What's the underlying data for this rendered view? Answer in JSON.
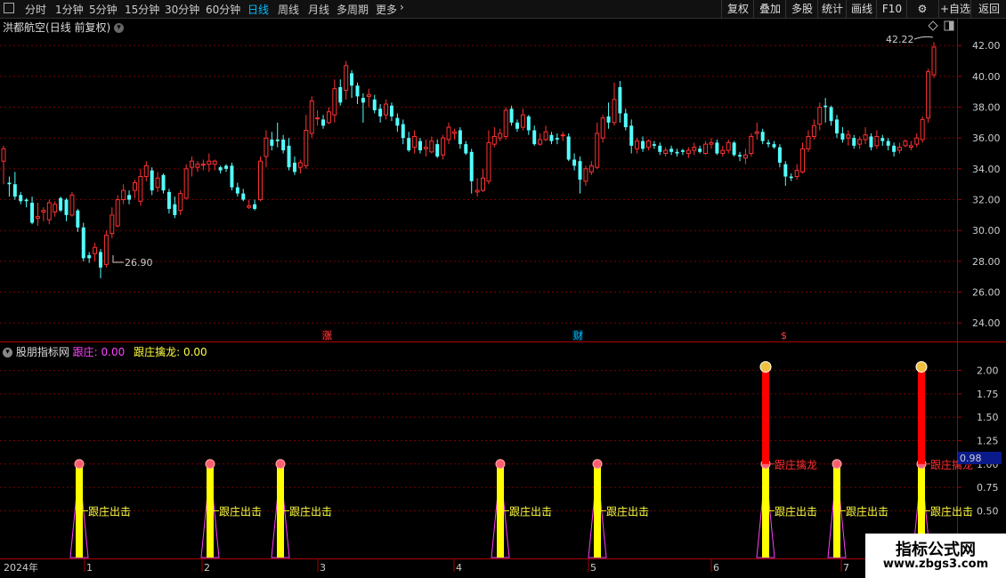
{
  "toolbar": {
    "icon": "window-icon",
    "periods": [
      "分时",
      "1分钟",
      "5分钟",
      "15分钟",
      "30分钟",
      "60分钟",
      "日线",
      "周线",
      "月线",
      "多周期",
      "更多"
    ],
    "active_period": "日线",
    "right_buttons": [
      "复权",
      "叠加",
      "多股",
      "统计",
      "画线",
      "F10",
      "+自选",
      "返回"
    ]
  },
  "main_pane": {
    "stock_name": "洪都航空",
    "mode": "(日线 前复权)",
    "high_label": "42.22",
    "low_label": "26.90",
    "markers": [
      {
        "text": "涨",
        "color": "#ff4040"
      },
      {
        "text": "财",
        "color": "#00bfff"
      },
      {
        "text": "$",
        "color": "#ff4040"
      }
    ]
  },
  "indicator_pane": {
    "name": "股朋指标网",
    "series_a_label": "跟庄:",
    "series_a_value": "0.00",
    "series_b_label": "跟庄擒龙:",
    "series_b_value": "0.00",
    "current_value": "0.98",
    "signal_exit_label": "跟庄出击",
    "signal_dragon_label": "跟庄擒龙"
  },
  "chart_data": {
    "type": "candlestick",
    "price_axis": {
      "ticks": [
        "42.00",
        "40.00",
        "38.00",
        "36.00",
        "34.00",
        "32.00",
        "30.00",
        "28.00",
        "26.00",
        "24.00"
      ],
      "ylim": [
        22.8,
        43.8
      ],
      "grid": true
    },
    "indicator_axis": {
      "ticks": [
        "2.00",
        "1.75",
        "1.50",
        "1.25",
        "1.00",
        "0.75",
        "0.50"
      ],
      "ylim": [
        0,
        2.3
      ]
    },
    "x_axis": {
      "labels": [
        "2024年",
        "1",
        "2",
        "3",
        "4",
        "5",
        "6",
        "7"
      ]
    },
    "candles": [
      [
        34.5,
        35.3,
        33.0,
        35.5
      ],
      [
        33.1,
        33.0,
        32.2,
        33.5
      ],
      [
        33.0,
        32.2,
        32.0,
        33.8
      ],
      [
        32.3,
        31.9,
        31.7,
        32.5
      ],
      [
        32.0,
        31.9,
        31.5,
        32.1
      ],
      [
        31.8,
        30.5,
        30.4,
        32.2
      ],
      [
        30.8,
        30.9,
        30.3,
        31.8
      ],
      [
        31.2,
        31.3,
        30.6,
        31.5
      ],
      [
        30.7,
        31.8,
        30.4,
        32.0
      ],
      [
        31.2,
        31.7,
        30.9,
        31.9
      ],
      [
        32.1,
        31.3,
        31.2,
        32.2
      ],
      [
        32.0,
        31.0,
        30.6,
        32.1
      ],
      [
        31.0,
        32.3,
        30.9,
        32.5
      ],
      [
        31.3,
        30.2,
        29.9,
        31.4
      ],
      [
        30.2,
        28.2,
        28.0,
        30.5
      ],
      [
        28.4,
        28.2,
        27.9,
        28.6
      ],
      [
        28.5,
        28.9,
        28.0,
        29.2
      ],
      [
        28.6,
        27.6,
        26.9,
        28.8
      ],
      [
        27.8,
        29.7,
        27.6,
        30.0
      ],
      [
        29.8,
        31.0,
        29.5,
        31.5
      ],
      [
        30.3,
        32.0,
        30.2,
        32.3
      ],
      [
        32.0,
        32.6,
        31.7,
        33.0
      ],
      [
        32.3,
        32.0,
        31.7,
        32.6
      ],
      [
        32.6,
        33.1,
        32.1,
        33.3
      ],
      [
        31.9,
        33.5,
        31.6,
        34.0
      ],
      [
        33.5,
        34.2,
        33.2,
        34.5
      ],
      [
        33.9,
        32.6,
        32.3,
        34.1
      ],
      [
        32.8,
        33.4,
        32.5,
        33.8
      ],
      [
        33.6,
        32.6,
        32.4,
        33.7
      ],
      [
        32.5,
        31.4,
        31.1,
        32.7
      ],
      [
        31.7,
        31.0,
        30.8,
        32.2
      ],
      [
        31.3,
        32.4,
        31.0,
        32.6
      ],
      [
        32.1,
        34.0,
        32.0,
        34.3
      ],
      [
        34.1,
        34.5,
        33.5,
        34.8
      ],
      [
        34.1,
        34.3,
        33.8,
        34.5
      ],
      [
        34.3,
        34.3,
        33.9,
        34.6
      ],
      [
        34.3,
        34.5,
        33.8,
        35.0
      ],
      [
        34.3,
        34.5,
        33.9,
        34.6
      ],
      [
        34.1,
        33.9,
        33.7,
        34.2
      ],
      [
        34.2,
        34.0,
        33.8,
        34.3
      ],
      [
        34.2,
        32.8,
        32.6,
        34.4
      ],
      [
        32.8,
        32.4,
        32.2,
        33.1
      ],
      [
        32.4,
        32.0,
        31.9,
        32.7
      ],
      [
        31.5,
        31.6,
        31.4,
        32.0
      ],
      [
        31.7,
        31.4,
        31.3,
        32.0
      ],
      [
        32.0,
        34.5,
        31.9,
        34.8
      ],
      [
        34.8,
        36.0,
        34.1,
        36.5
      ],
      [
        35.9,
        35.5,
        35.2,
        36.4
      ],
      [
        35.9,
        35.8,
        35.4,
        37.0
      ],
      [
        35.9,
        35.2,
        35.0,
        36.2
      ],
      [
        35.5,
        34.1,
        33.9,
        36.0
      ],
      [
        34.4,
        33.8,
        33.6,
        34.8
      ],
      [
        34.1,
        34.4,
        33.7,
        34.6
      ],
      [
        34.2,
        36.5,
        34.0,
        37.5
      ],
      [
        36.3,
        38.4,
        36.0,
        38.7
      ],
      [
        37.3,
        37.3,
        36.8,
        37.8
      ],
      [
        37.2,
        36.8,
        36.6,
        37.5
      ],
      [
        37.0,
        37.7,
        36.9,
        38.0
      ],
      [
        37.5,
        39.2,
        37.0,
        39.8
      ],
      [
        39.3,
        38.3,
        38.1,
        39.8
      ],
      [
        39.1,
        40.7,
        38.5,
        41.0
      ],
      [
        40.2,
        39.4,
        38.6,
        40.4
      ],
      [
        39.4,
        38.7,
        38.2,
        39.6
      ],
      [
        38.6,
        38.3,
        37.0,
        38.9
      ],
      [
        38.7,
        38.8,
        38.0,
        39.2
      ],
      [
        38.5,
        37.8,
        37.6,
        38.8
      ],
      [
        37.9,
        37.4,
        37.0,
        38.2
      ],
      [
        37.5,
        38.2,
        37.2,
        38.5
      ],
      [
        38.1,
        37.4,
        37.1,
        38.3
      ],
      [
        37.3,
        36.8,
        36.4,
        37.6
      ],
      [
        36.9,
        36.0,
        35.6,
        37.2
      ],
      [
        36.0,
        35.2,
        35.1,
        36.4
      ],
      [
        35.4,
        36.1,
        35.0,
        36.5
      ],
      [
        35.8,
        35.2,
        35.0,
        36.0
      ],
      [
        35.3,
        35.4,
        34.8,
        35.9
      ],
      [
        35.1,
        35.8,
        35.0,
        36.1
      ],
      [
        35.6,
        34.8,
        34.7,
        35.9
      ],
      [
        34.9,
        36.0,
        34.6,
        36.2
      ],
      [
        35.9,
        36.7,
        35.6,
        37.0
      ],
      [
        36.3,
        36.4,
        35.9,
        36.6
      ],
      [
        36.5,
        35.6,
        35.3,
        36.7
      ],
      [
        35.6,
        35.0,
        34.9,
        35.8
      ],
      [
        35.1,
        33.2,
        32.4,
        35.3
      ],
      [
        32.5,
        32.6,
        32.2,
        33.4
      ],
      [
        32.6,
        33.4,
        32.5,
        34.0
      ],
      [
        33.2,
        35.7,
        33.0,
        36.5
      ],
      [
        35.6,
        36.1,
        35.4,
        36.7
      ],
      [
        36.0,
        36.3,
        35.8,
        36.6
      ],
      [
        36.1,
        37.8,
        35.9,
        38.0
      ],
      [
        37.9,
        37.0,
        36.8,
        38.1
      ],
      [
        37.0,
        36.6,
        36.4,
        37.2
      ],
      [
        36.7,
        37.5,
        36.5,
        37.9
      ],
      [
        37.4,
        36.5,
        36.2,
        37.5
      ],
      [
        36.5,
        35.6,
        35.5,
        36.8
      ],
      [
        35.6,
        35.9,
        35.5,
        36.3
      ],
      [
        35.9,
        36.4,
        35.8,
        36.8
      ],
      [
        36.2,
        35.8,
        35.6,
        36.4
      ],
      [
        36.0,
        35.9,
        35.6,
        36.3
      ],
      [
        36.2,
        36.2,
        35.8,
        36.4
      ],
      [
        36.1,
        34.6,
        34.5,
        36.3
      ],
      [
        34.6,
        34.2,
        33.9,
        35.0
      ],
      [
        34.5,
        33.3,
        32.4,
        34.8
      ],
      [
        33.2,
        34.0,
        32.9,
        34.2
      ],
      [
        33.8,
        34.2,
        33.6,
        34.5
      ],
      [
        34.1,
        36.3,
        34.0,
        37.0
      ],
      [
        36.0,
        37.3,
        35.7,
        37.5
      ],
      [
        37.4,
        37.0,
        36.6,
        38.3
      ],
      [
        37.0,
        38.5,
        36.8,
        39.6
      ],
      [
        39.3,
        37.6,
        37.0,
        39.7
      ],
      [
        37.6,
        36.7,
        36.5,
        37.9
      ],
      [
        36.8,
        35.5,
        35.0,
        37.2
      ],
      [
        35.3,
        35.8,
        35.0,
        36.0
      ],
      [
        35.8,
        35.3,
        35.1,
        36.1
      ],
      [
        35.4,
        35.8,
        35.2,
        35.9
      ],
      [
        35.6,
        35.5,
        35.3,
        35.8
      ],
      [
        35.5,
        35.1,
        34.9,
        35.7
      ],
      [
        35.0,
        35.2,
        34.8,
        35.4
      ],
      [
        35.3,
        35.1,
        34.9,
        35.5
      ],
      [
        35.1,
        35.0,
        34.8,
        35.3
      ],
      [
        35.2,
        35.1,
        34.9,
        35.3
      ],
      [
        35.0,
        35.2,
        34.7,
        35.4
      ],
      [
        35.2,
        35.4,
        34.9,
        35.7
      ],
      [
        35.3,
        35.1,
        35.0,
        35.5
      ],
      [
        35.0,
        35.6,
        34.9,
        35.8
      ],
      [
        35.6,
        35.7,
        35.3,
        36.0
      ],
      [
        35.7,
        35.0,
        34.9,
        35.9
      ],
      [
        35.0,
        35.2,
        34.8,
        35.5
      ],
      [
        35.2,
        35.7,
        35.0,
        35.9
      ],
      [
        35.7,
        34.9,
        34.8,
        35.8
      ],
      [
        34.9,
        34.8,
        34.5,
        35.1
      ],
      [
        34.7,
        34.9,
        34.3,
        35.3
      ],
      [
        35.0,
        36.1,
        34.8,
        36.3
      ],
      [
        36.3,
        36.4,
        35.9,
        37.0
      ],
      [
        36.4,
        35.8,
        35.6,
        36.6
      ],
      [
        35.7,
        35.6,
        35.4,
        35.9
      ],
      [
        35.6,
        35.4,
        35.3,
        35.8
      ],
      [
        35.4,
        34.4,
        34.1,
        35.6
      ],
      [
        34.3,
        33.5,
        32.9,
        34.5
      ],
      [
        33.5,
        33.4,
        33.2,
        33.7
      ],
      [
        33.5,
        33.9,
        33.3,
        34.3
      ],
      [
        33.8,
        35.3,
        33.7,
        35.7
      ],
      [
        35.3,
        36.1,
        35.1,
        36.5
      ],
      [
        36.1,
        36.8,
        35.9,
        37.2
      ],
      [
        36.9,
        38.0,
        36.5,
        38.3
      ],
      [
        38.1,
        38.0,
        37.0,
        38.6
      ],
      [
        38.0,
        37.1,
        36.8,
        38.1
      ],
      [
        37.2,
        36.3,
        36.0,
        37.5
      ],
      [
        36.3,
        35.9,
        35.7,
        36.7
      ],
      [
        36.0,
        36.2,
        35.5,
        36.5
      ],
      [
        36.0,
        35.5,
        35.3,
        36.2
      ],
      [
        35.6,
        35.9,
        35.3,
        36.1
      ],
      [
        35.9,
        36.2,
        35.6,
        36.7
      ],
      [
        36.1,
        35.4,
        35.2,
        36.3
      ],
      [
        35.5,
        36.1,
        35.3,
        36.5
      ],
      [
        36.0,
        35.8,
        35.5,
        36.2
      ],
      [
        35.8,
        35.5,
        35.2,
        36.0
      ],
      [
        35.5,
        35.1,
        34.8,
        35.7
      ],
      [
        35.2,
        35.4,
        35.0,
        35.7
      ],
      [
        35.5,
        35.8,
        35.4,
        35.9
      ],
      [
        35.4,
        35.5,
        35.2,
        35.8
      ],
      [
        35.6,
        36.0,
        35.4,
        36.3
      ],
      [
        35.9,
        37.2,
        35.7,
        37.4
      ],
      [
        37.3,
        40.3,
        37.0,
        40.5
      ],
      [
        40.1,
        41.9,
        39.9,
        42.22
      ]
    ],
    "exit_signal_positions": [
      89,
      236,
      315,
      562,
      671,
      860,
      940,
      1035
    ],
    "dragon_signal_positions": [
      860,
      1035
    ],
    "dragon_value": 2.0,
    "exit_value": 1.0
  }
}
